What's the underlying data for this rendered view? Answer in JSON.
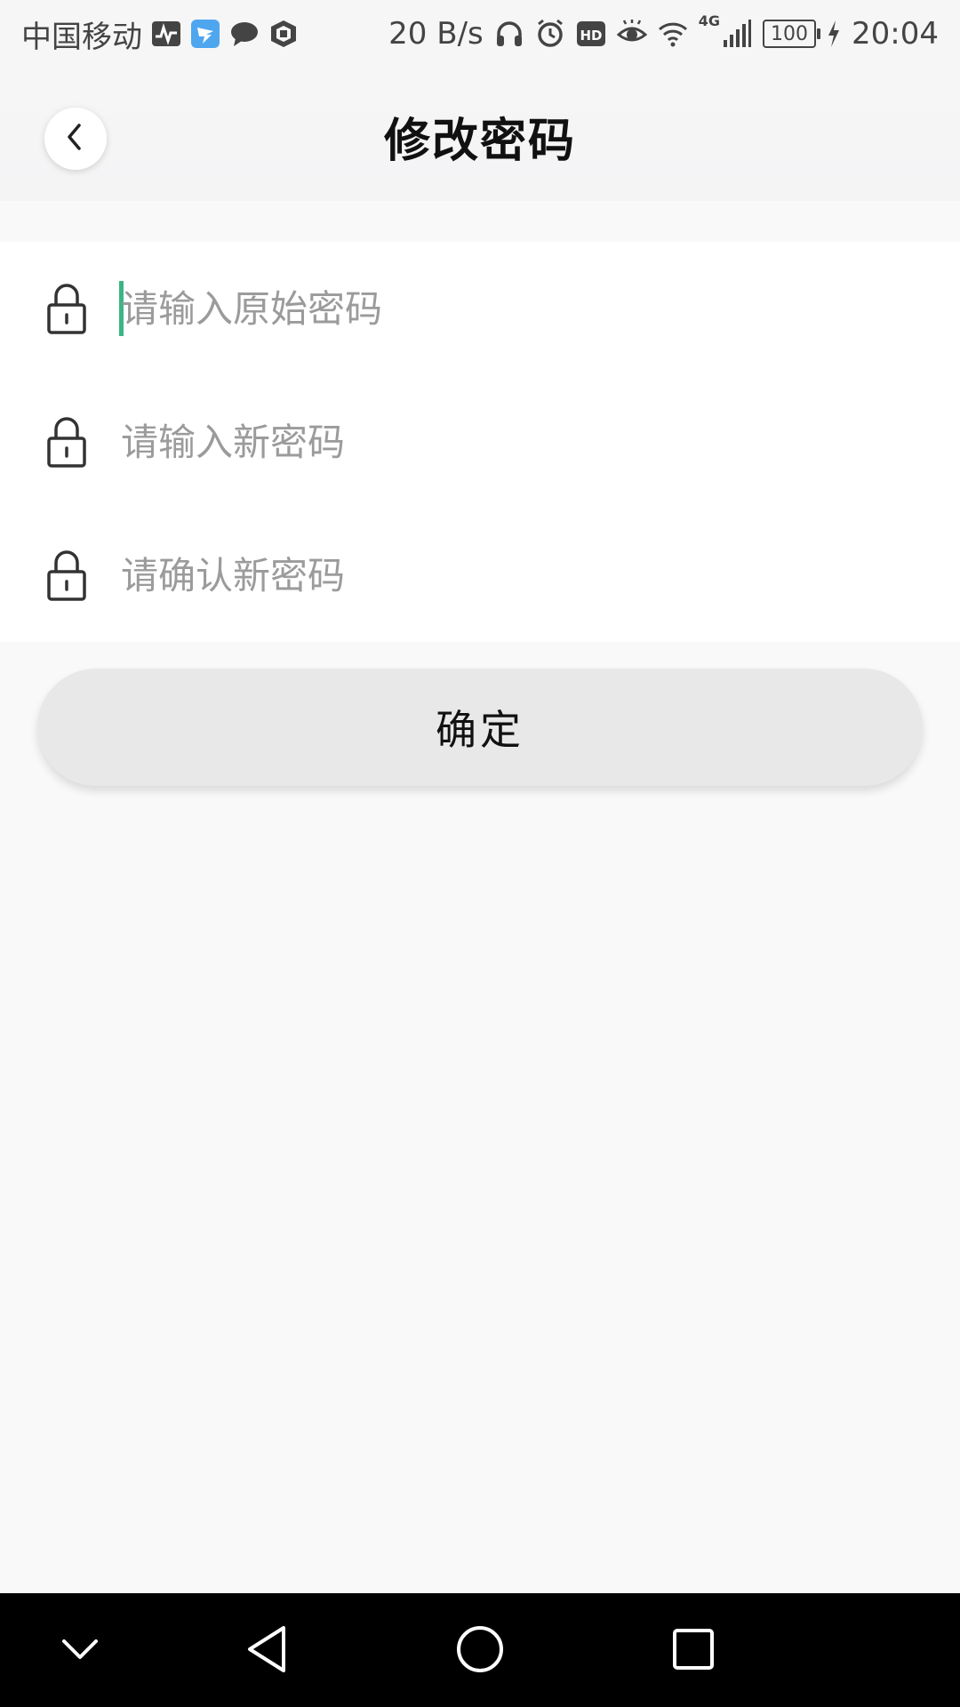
{
  "status_bar": {
    "carrier": "中国移动",
    "network_speed": "20 B/s",
    "network_type": "4G",
    "battery": "100",
    "time": "20:04",
    "left_icons": [
      "activity-icon",
      "dingtalk-icon",
      "chat-bubble-icon",
      "shield-icon"
    ],
    "right_icons": [
      "headphones-icon",
      "alarm-icon",
      "hd-icon",
      "eye-icon",
      "wifi-icon",
      "signal-icon",
      "charging-icon"
    ]
  },
  "header": {
    "title": "修改密码",
    "back_icon": "chevron-left-icon"
  },
  "form": {
    "fields": [
      {
        "placeholder": "请输入原始密码",
        "value": "",
        "icon": "lock-icon",
        "focused": true
      },
      {
        "placeholder": "请输入新密码",
        "value": "",
        "icon": "lock-icon",
        "focused": false
      },
      {
        "placeholder": "请确认新密码",
        "value": "",
        "icon": "lock-icon",
        "focused": false
      }
    ]
  },
  "confirm_button": {
    "label": "确定"
  },
  "nav_bar": {
    "icons": [
      "chevron-down-icon",
      "back-triangle-icon",
      "home-circle-icon",
      "recents-square-icon"
    ]
  },
  "colors": {
    "accent_caret": "#3bb586",
    "background": "#f9f9fa",
    "button_bg": "#e8e8e9",
    "placeholder": "#9b9b9b"
  }
}
